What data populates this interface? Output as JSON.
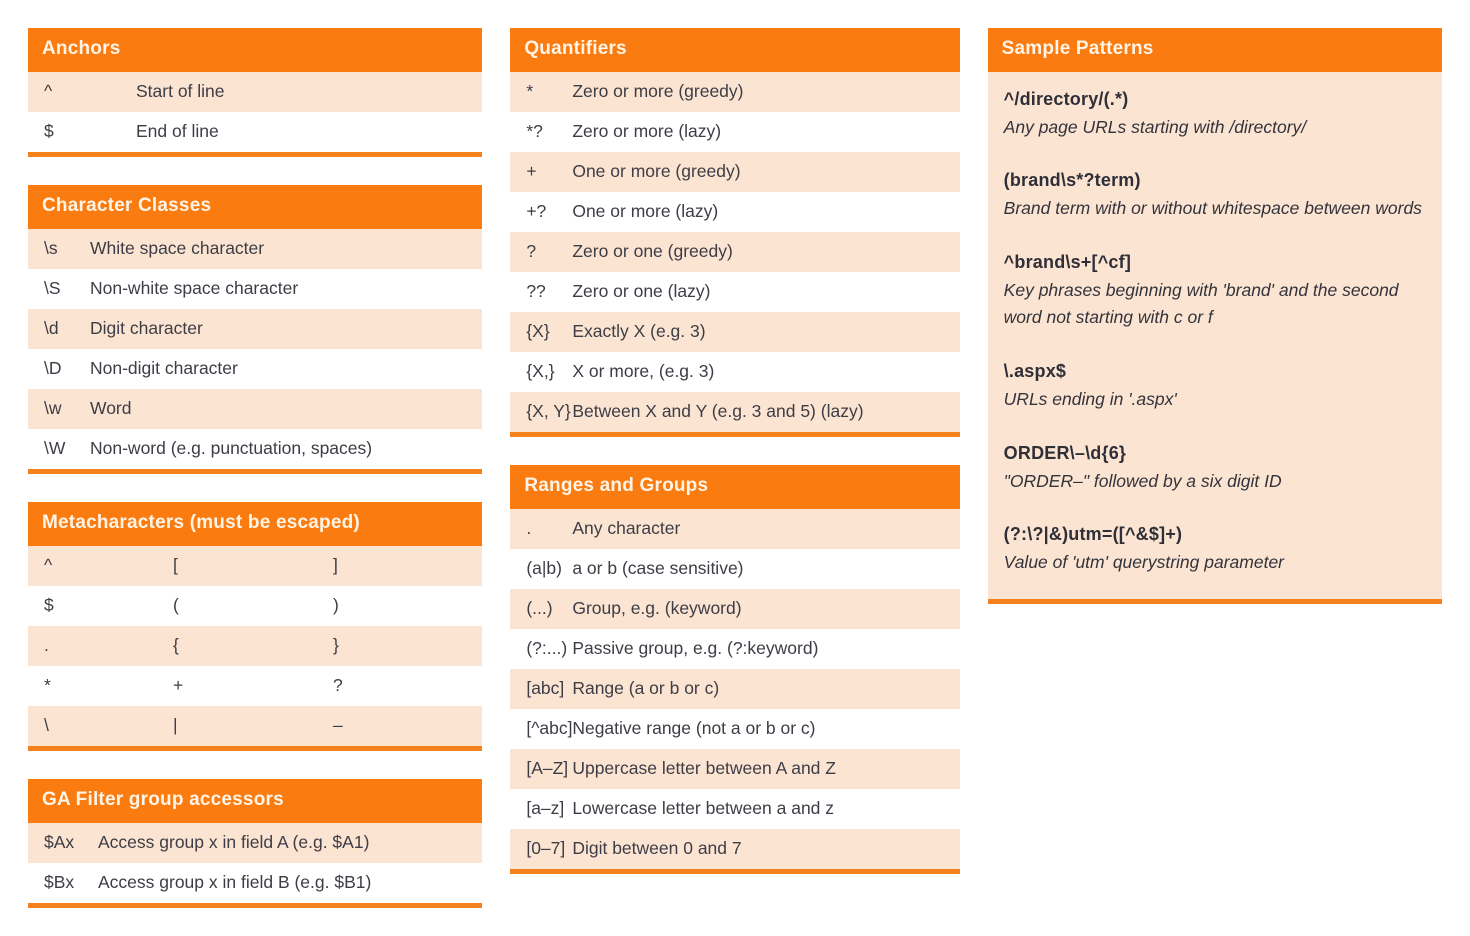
{
  "colors": {
    "header_orange": "#FA7B10",
    "rule_orange": "#F5811E",
    "row_alt": "#FCE4D2",
    "text": "#3d3d46",
    "header_text": "#FFF4E6"
  },
  "columns": [
    {
      "name": "left",
      "cards": [
        {
          "id": "anchors",
          "title": "Anchors",
          "layout": "sym-desc-wide",
          "rows": [
            {
              "sym": "^",
              "desc": "Start of line"
            },
            {
              "sym": "$",
              "desc": "End of line"
            }
          ]
        },
        {
          "id": "character-classes",
          "title": "Character Classes",
          "layout": "sym-desc",
          "rows": [
            {
              "sym": "\\s",
              "desc": "White space character"
            },
            {
              "sym": "\\S",
              "desc": "Non-white space character"
            },
            {
              "sym": "\\d",
              "desc": "Digit character"
            },
            {
              "sym": "\\D",
              "desc": "Non-digit character"
            },
            {
              "sym": "\\w",
              "desc": "Word"
            },
            {
              "sym": "\\W",
              "desc": "Non-word (e.g. punctuation, spaces)"
            }
          ]
        },
        {
          "id": "metacharacters",
          "title": "Metacharacters (must be escaped)",
          "layout": "triple",
          "rows": [
            {
              "c0": "^",
              "c1": "[",
              "c2": "]"
            },
            {
              "c0": "$",
              "c1": "(",
              "c2": ")"
            },
            {
              "c0": ".",
              "c1": "{",
              "c2": "}"
            },
            {
              "c0": "*",
              "c1": "+",
              "c2": "?"
            },
            {
              "c0": "\\",
              "c1": "|",
              "c2": "–"
            }
          ]
        },
        {
          "id": "ga-filter-group-accessors",
          "title": "GA Filter group accessors",
          "layout": "sym-desc",
          "rows": [
            {
              "sym": "$Ax",
              "desc": "Access group x in field A (e.g. $A1)"
            },
            {
              "sym": "$Bx",
              "desc": "Access group x in field B (e.g. $B1)"
            }
          ]
        }
      ]
    },
    {
      "name": "middle",
      "cards": [
        {
          "id": "quantifiers",
          "title": "Quantifiers",
          "layout": "sym-desc",
          "rows": [
            {
              "sym": "*",
              "desc": "Zero or more (greedy)"
            },
            {
              "sym": "*?",
              "desc": "Zero or more (lazy)"
            },
            {
              "sym": "+",
              "desc": "One or more (greedy)"
            },
            {
              "sym": "+?",
              "desc": "One or more (lazy)"
            },
            {
              "sym": "?",
              "desc": "Zero or one (greedy)"
            },
            {
              "sym": "??",
              "desc": "Zero or one (lazy)"
            },
            {
              "sym": "{X}",
              "desc": "Exactly X (e.g. 3)"
            },
            {
              "sym": "{X,}",
              "desc": "X or more, (e.g. 3)"
            },
            {
              "sym": "{X, Y}",
              "desc": "Between X and Y (e.g. 3 and 5) (lazy)"
            }
          ]
        },
        {
          "id": "ranges-and-groups",
          "title": "Ranges and Groups",
          "layout": "sym-desc",
          "rows": [
            {
              "sym": ".",
              "desc": "Any character"
            },
            {
              "sym": "(a|b)",
              "desc": "a or b (case sensitive)"
            },
            {
              "sym": "(...)",
              "desc": "Group, e.g. (keyword)"
            },
            {
              "sym": "(?:...)",
              "desc": "Passive group, e.g. (?:keyword)"
            },
            {
              "sym": "[abc]",
              "desc": "Range (a or b or c)"
            },
            {
              "sym": "[^abc]",
              "desc": "Negative range (not a or b or c)"
            },
            {
              "sym": "[A–Z]",
              "desc": "Uppercase letter between A and Z"
            },
            {
              "sym": "[a–z]",
              "desc": "Lowercase letter between a and z"
            },
            {
              "sym": "[0–7]",
              "desc": "Digit between 0 and 7"
            }
          ]
        }
      ]
    },
    {
      "name": "right",
      "cards": [
        {
          "id": "sample-patterns",
          "title": "Sample Patterns",
          "layout": "samples",
          "samples": [
            {
              "pattern": "^/directory/(.*)",
              "meaning": "Any page URLs starting with /directory/"
            },
            {
              "pattern": "(brand\\s*?term)",
              "meaning": "Brand term with or without whitespace between words"
            },
            {
              "pattern": "^brand\\s+[^cf]",
              "meaning": "Key phrases beginning with 'brand' and the second word not starting with c or f"
            },
            {
              "pattern": "\\.aspx$",
              "meaning": "URLs ending in '.aspx'"
            },
            {
              "pattern": "ORDER\\–\\d{6}",
              "meaning": "\"ORDER–\" followed by a six digit ID"
            },
            {
              "pattern": "(?:\\?|&)utm=([^&$]+)",
              "meaning": "Value of 'utm' querystring parameter"
            }
          ]
        }
      ]
    }
  ]
}
